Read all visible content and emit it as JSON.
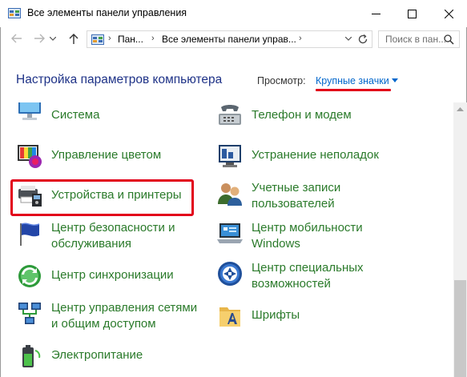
{
  "window": {
    "title": "Все элементы панели управления",
    "controls": [
      "minimize-icon",
      "maximize-icon",
      "close-icon"
    ]
  },
  "address_bar": {
    "breadcrumbs": [
      "Пан...",
      "Все элементы панели управ..."
    ],
    "search_placeholder": "Поиск в пан..."
  },
  "header": {
    "title": "Настройка параметров компьютера",
    "view_label": "Просмотр:",
    "view_value": "Крупные значки",
    "accent_color": "#e2001a"
  },
  "items": [
    {
      "label": "Система",
      "icon": "system-monitor-icon"
    },
    {
      "label": "Телефон и модем",
      "icon": "phone-modem-icon"
    },
    {
      "label": "Управление цветом",
      "icon": "color-management-icon"
    },
    {
      "label": "Устранение неполадок",
      "icon": "troubleshooting-icon"
    },
    {
      "label": "Устройства и принтеры",
      "icon": "devices-printers-icon",
      "highlighted": true
    },
    {
      "label": "Учетные записи пользователей",
      "icon": "user-accounts-icon"
    },
    {
      "label": "Центр безопасности и обслуживания",
      "icon": "security-flag-icon"
    },
    {
      "label": "Центр мобильности Windows",
      "icon": "mobility-center-icon"
    },
    {
      "label": "Центр синхронизации",
      "icon": "sync-center-icon"
    },
    {
      "label": "Центр специальных возможностей",
      "icon": "accessibility-icon"
    },
    {
      "label": "Центр управления сетями и общим доступом",
      "icon": "network-center-icon"
    },
    {
      "label": "Шрифты",
      "icon": "fonts-folder-icon"
    },
    {
      "label": "Электропитание",
      "icon": "power-battery-icon"
    }
  ]
}
